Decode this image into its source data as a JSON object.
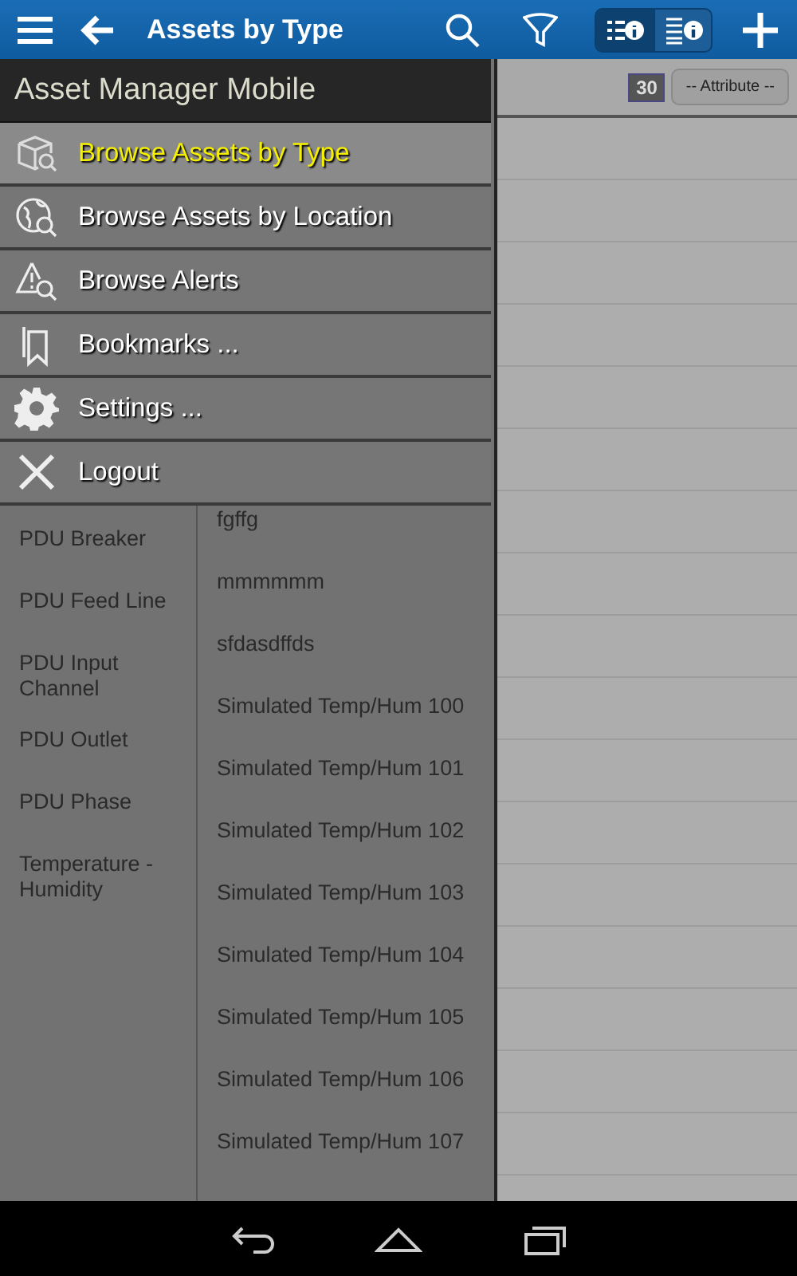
{
  "app_bar": {
    "title": "Assets by Type",
    "view_toggle": [
      {
        "selected": true
      },
      {
        "selected": false
      }
    ]
  },
  "types": [
    "PDU Breaker",
    "PDU Feed Line",
    "PDU Input Channel",
    "PDU Outlet",
    "PDU Phase",
    "Temperature - Humidity"
  ],
  "assets": [
    "fgffg",
    "mmmmmm",
    "sfdasdffds",
    "Simulated Temp/Hum 100",
    "Simulated Temp/Hum 101",
    "Simulated Temp/Hum 102",
    "Simulated Temp/Hum 103",
    "Simulated Temp/Hum 104",
    "Simulated Temp/Hum 105",
    "Simulated Temp/Hum 106",
    "Simulated Temp/Hum 107"
  ],
  "detail": {
    "count": "30",
    "attribute_button": "-- Attribute --"
  },
  "drawer": {
    "title": "Asset Manager Mobile",
    "items": [
      {
        "label": "Browse Assets by Type",
        "kind": "type",
        "selected": true
      },
      {
        "label": "Browse Assets by Location",
        "kind": "location",
        "selected": false
      },
      {
        "label": "Browse Alerts",
        "kind": "alerts",
        "selected": false
      },
      {
        "label": "Bookmarks ...",
        "kind": "bookmarks",
        "selected": false
      },
      {
        "label": "Settings ...",
        "kind": "settings",
        "selected": false
      },
      {
        "label": "Logout",
        "kind": "logout",
        "selected": false
      }
    ]
  }
}
